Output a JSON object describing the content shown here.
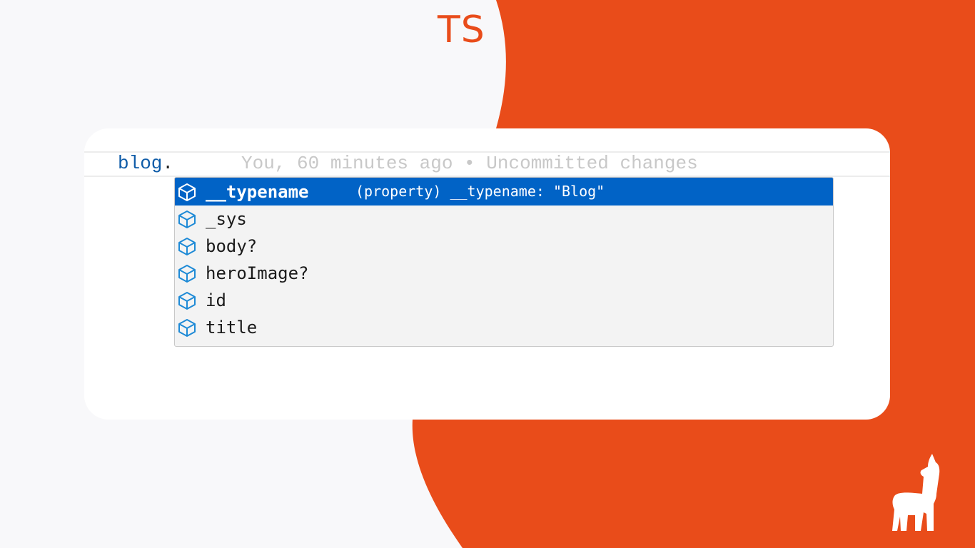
{
  "header": {
    "badge": "TS"
  },
  "editor": {
    "expression": "blog",
    "dot": ".",
    "blame": "You, 60 minutes ago • Uncommitted changes"
  },
  "suggestions": {
    "items": [
      {
        "label": "__typename",
        "icon": "property-cube-icon",
        "selected": true
      },
      {
        "label": "_sys",
        "icon": "property-cube-icon"
      },
      {
        "label": "body?",
        "icon": "property-cube-icon"
      },
      {
        "label": "heroImage?",
        "icon": "property-cube-icon"
      },
      {
        "label": "id",
        "icon": "property-cube-icon"
      },
      {
        "label": "title",
        "icon": "property-cube-icon"
      }
    ],
    "selected_detail": "(property) __typename: \"Blog\""
  },
  "brand": {
    "logo_icon": "llama-logo-icon"
  },
  "colors": {
    "accent": "#e94c1a",
    "selection": "#0163c6",
    "code_object": "#0f5ca8",
    "icon_blue": "#1e8ad6"
  }
}
